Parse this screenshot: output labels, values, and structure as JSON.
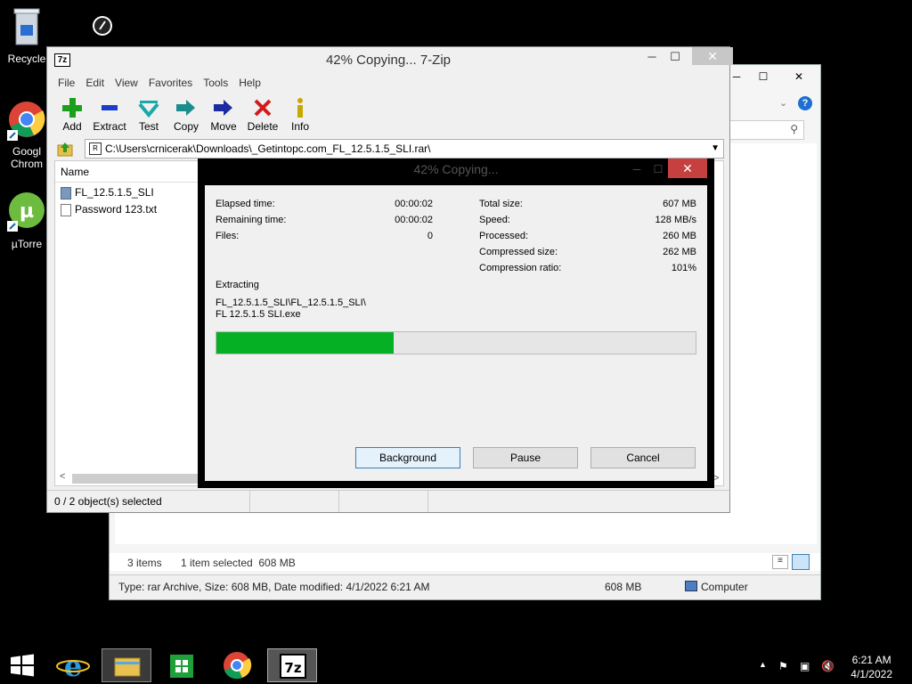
{
  "desktop": {
    "icons": [
      {
        "label": "Recycle"
      },
      {
        "label": "Googl\nChrom"
      },
      {
        "label": "µTorre"
      }
    ]
  },
  "explorer": {
    "status_items": "3 items",
    "status_selected": "1 item selected  608 MB",
    "details_text": "Type: rar Archive, Size: 608 MB, Date modified: 4/1/2022 6:21 AM",
    "details_size": "608 MB",
    "details_location": "Computer"
  },
  "zip": {
    "title": "42% Copying... 7-Zip",
    "menu": [
      "File",
      "Edit",
      "View",
      "Favorites",
      "Tools",
      "Help"
    ],
    "toolbar": {
      "add": "Add",
      "extract": "Extract",
      "test": "Test",
      "copy": "Copy",
      "move": "Move",
      "delete": "Delete",
      "info": "Info"
    },
    "address": "C:\\Users\\crnicerak\\Downloads\\_Getintopc.com_FL_12.5.1.5_SLI.rar\\",
    "column_name": "Name",
    "files": [
      "FL_12.5.1.5_SLI",
      "Password 123.txt"
    ],
    "status": "0 / 2 object(s) selected"
  },
  "progress": {
    "title": "42% Copying...",
    "elapsed_label": "Elapsed time:",
    "elapsed_value": "00:00:02",
    "remaining_label": "Remaining time:",
    "remaining_value": "00:00:02",
    "files_label": "Files:",
    "files_value": "0",
    "total_label": "Total size:",
    "total_value": "607 MB",
    "speed_label": "Speed:",
    "speed_value": "128 MB/s",
    "processed_label": "Processed:",
    "processed_value": "260 MB",
    "compressed_label": "Compressed size:",
    "compressed_value": "262 MB",
    "ratio_label": "Compression ratio:",
    "ratio_value": "101%",
    "action_label": "Extracting",
    "path_line1": "FL_12.5.1.5_SLI\\FL_12.5.1.5_SLI\\",
    "path_line2": "FL 12.5.1.5 SLI.exe",
    "percent": 37,
    "bar_color": "#06b025",
    "btn_background": "Background",
    "btn_pause": "Pause",
    "btn_cancel": "Cancel"
  },
  "taskbar": {
    "time": "6:21 AM",
    "date": "4/1/2022"
  }
}
